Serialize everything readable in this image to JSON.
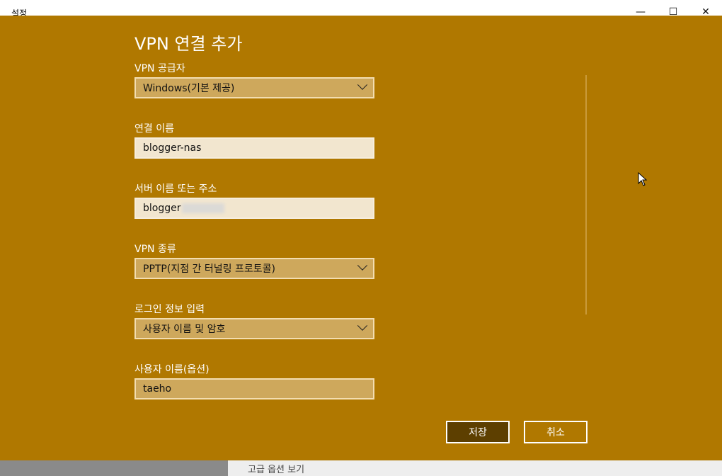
{
  "window": {
    "title": "설정",
    "bottom_text": "고급 옵션 보기"
  },
  "dialog": {
    "title": "VPN 연결 추가",
    "fields": {
      "vpn_provider": {
        "label": "VPN 공급자",
        "value": "Windows(기본 제공)"
      },
      "connection_name": {
        "label": "연결 이름",
        "value": "blogger-nas"
      },
      "server_address": {
        "label": "서버 이름 또는 주소",
        "value": "blogger"
      },
      "vpn_type": {
        "label": "VPN 종류",
        "value": "PPTP(지점 간 터널링 프로토콜)"
      },
      "signin_info": {
        "label": "로그인 정보 입력",
        "value": "사용자 이름 및 암호"
      },
      "username": {
        "label": "사용자 이름(옵션)",
        "value": "taeho"
      }
    },
    "buttons": {
      "save": "저장",
      "cancel": "취소"
    }
  },
  "colors": {
    "dialog_bg": "#b07800",
    "primary_button": "#5d3f00"
  }
}
